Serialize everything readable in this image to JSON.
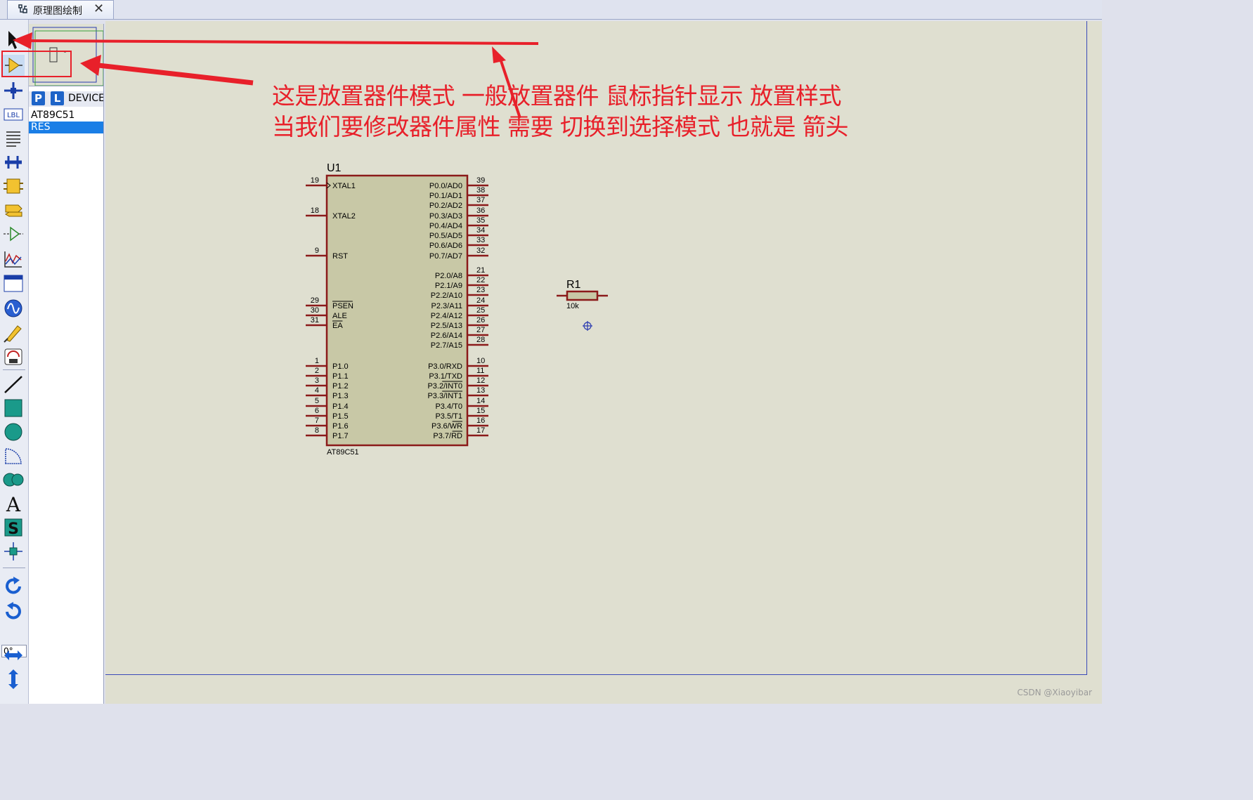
{
  "tab": {
    "title": "原理图绘制",
    "close_symbol": "✕"
  },
  "toolbar": {
    "tools": [
      "selection-mode",
      "component-mode",
      "junction-dot",
      "wire-label",
      "text-script",
      "buses",
      "subcircuit",
      "terminals",
      "device-pins",
      "graph",
      "tape-recorder",
      "generator",
      "voltage-probe",
      "virtual-instruments",
      "line-2d",
      "box-2d",
      "circle-2d",
      "arc-2d",
      "closed-path-2d",
      "text-2d",
      "symbols-2d",
      "markers-2d"
    ],
    "angle": "0°",
    "transform": [
      "rotate-clockwise",
      "rotate-anticlockwise",
      "mirror-x",
      "mirror-y"
    ]
  },
  "panel": {
    "p_label": "P",
    "l_label": "L",
    "devices_label": "DEVICES",
    "devices": [
      "AT89C51",
      "RES"
    ],
    "selected": "RES"
  },
  "annotation": {
    "line1": "这是放置器件模式     一般放置器件 鼠标指针显示 放置样式",
    "line2": "当我们要修改器件属性 需要 切换到选择模式  也就是 箭头",
    "color": "#e8202a"
  },
  "u1": {
    "ref": "U1",
    "part": "AT89C51",
    "left_pins": [
      {
        "num": "19",
        "name": "XTAL1"
      },
      {
        "num": "18",
        "name": "XTAL2"
      },
      {
        "num": "9",
        "name": "RST"
      },
      {
        "num": "29",
        "name": "PSEN",
        "bar": true
      },
      {
        "num": "30",
        "name": "ALE"
      },
      {
        "num": "31",
        "name": "EA",
        "bar": true
      },
      {
        "num": "1",
        "name": "P1.0"
      },
      {
        "num": "2",
        "name": "P1.1"
      },
      {
        "num": "3",
        "name": "P1.2"
      },
      {
        "num": "4",
        "name": "P1.3"
      },
      {
        "num": "5",
        "name": "P1.4"
      },
      {
        "num": "6",
        "name": "P1.5"
      },
      {
        "num": "7",
        "name": "P1.6"
      },
      {
        "num": "8",
        "name": "P1.7"
      }
    ],
    "right_pins": [
      {
        "num": "39",
        "name": "P0.0/AD0"
      },
      {
        "num": "38",
        "name": "P0.1/AD1"
      },
      {
        "num": "37",
        "name": "P0.2/AD2"
      },
      {
        "num": "36",
        "name": "P0.3/AD3"
      },
      {
        "num": "35",
        "name": "P0.4/AD4"
      },
      {
        "num": "34",
        "name": "P0.5/AD5"
      },
      {
        "num": "33",
        "name": "P0.6/AD6"
      },
      {
        "num": "32",
        "name": "P0.7/AD7"
      },
      {
        "num": "21",
        "name": "P2.0/A8"
      },
      {
        "num": "22",
        "name": "P2.1/A9"
      },
      {
        "num": "23",
        "name": "P2.2/A10"
      },
      {
        "num": "24",
        "name": "P2.3/A11"
      },
      {
        "num": "25",
        "name": "P2.4/A12"
      },
      {
        "num": "26",
        "name": "P2.5/A13"
      },
      {
        "num": "27",
        "name": "P2.6/A14"
      },
      {
        "num": "28",
        "name": "P2.7/A15"
      },
      {
        "num": "10",
        "name": "P3.0/RXD"
      },
      {
        "num": "11",
        "name": "P3.1/TXD"
      },
      {
        "num": "12",
        "name": "P3.2/INT0",
        "bar": "INT0"
      },
      {
        "num": "13",
        "name": "P3.3/INT1",
        "bar": "INT1"
      },
      {
        "num": "14",
        "name": "P3.4/T0"
      },
      {
        "num": "15",
        "name": "P3.5/T1"
      },
      {
        "num": "16",
        "name": "P3.6/WR",
        "bar": "WR"
      },
      {
        "num": "17",
        "name": "P3.7/RD",
        "bar": "RD"
      }
    ]
  },
  "r1": {
    "ref": "R1",
    "value": "10k"
  },
  "watermark": "CSDN @Xiaoyibar"
}
